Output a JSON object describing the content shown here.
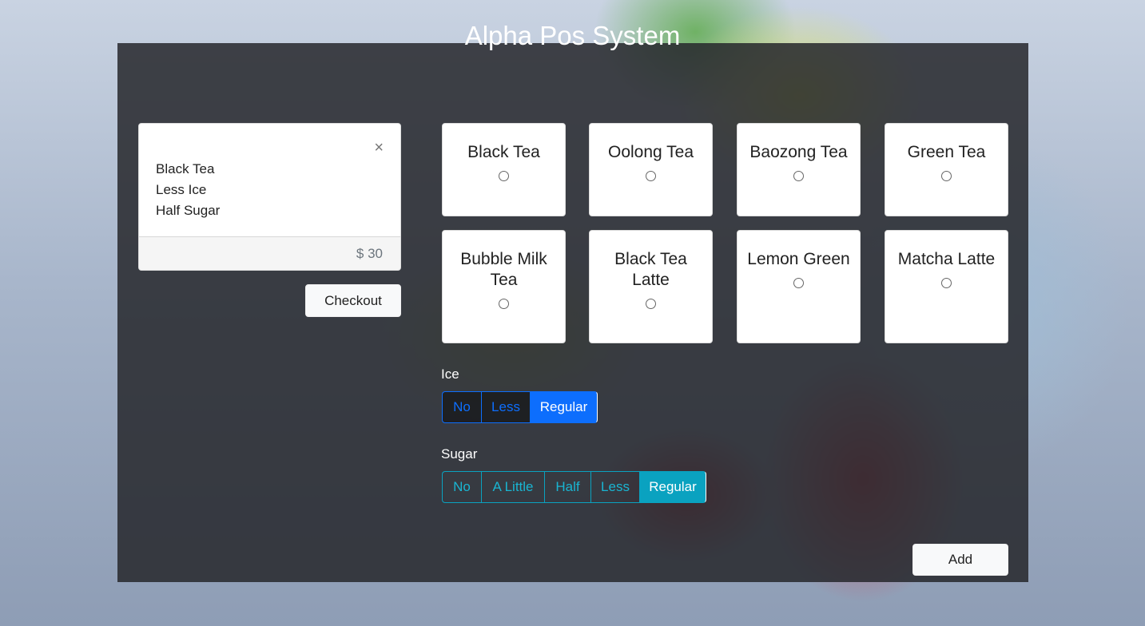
{
  "app": {
    "title": "Alpha Pos System"
  },
  "cart": {
    "close_glyph": "×",
    "item_name": "Black Tea",
    "ice": "Less Ice",
    "sugar": "Half Sugar",
    "price": "$ 30",
    "checkout_label": "Checkout"
  },
  "drinks": [
    {
      "name": "Black Tea"
    },
    {
      "name": "Oolong Tea"
    },
    {
      "name": "Baozong Tea"
    },
    {
      "name": "Green Tea"
    },
    {
      "name": "Bubble Milk Tea"
    },
    {
      "name": "Black Tea Latte"
    },
    {
      "name": "Lemon Green"
    },
    {
      "name": "Matcha Latte"
    }
  ],
  "ice": {
    "label": "Ice",
    "options": [
      "No",
      "Less",
      "Regular"
    ],
    "selected": "Regular"
  },
  "sugar": {
    "label": "Sugar",
    "options": [
      "No",
      "A Little",
      "Half",
      "Less",
      "Regular"
    ],
    "selected": "Regular"
  },
  "add_label": "Add",
  "colors": {
    "primary": "#0d6efd",
    "info": "#0aa2c0",
    "panel": "#26282c"
  }
}
